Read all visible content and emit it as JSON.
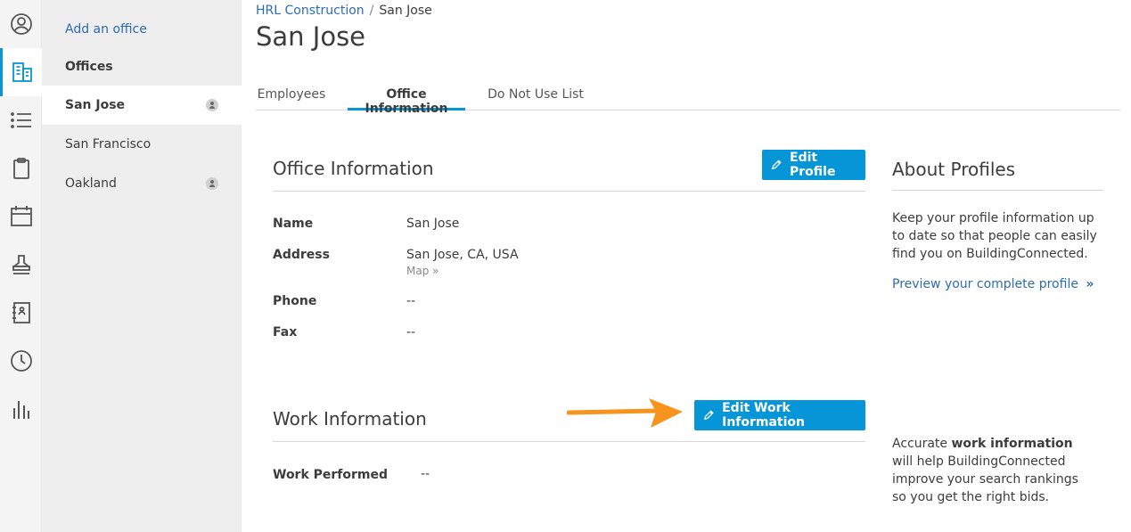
{
  "rail": {
    "items": [
      {
        "icon": "user-circle-icon"
      },
      {
        "icon": "building-icon",
        "active": true
      },
      {
        "icon": "list-icon"
      },
      {
        "icon": "clipboard-icon"
      },
      {
        "icon": "calendar-icon"
      },
      {
        "icon": "stamp-icon"
      },
      {
        "icon": "contacts-book-icon"
      },
      {
        "icon": "clock-icon"
      },
      {
        "icon": "bar-chart-icon"
      }
    ]
  },
  "offices_panel": {
    "add_office": "Add an office",
    "title": "Offices",
    "items": [
      {
        "label": "San Jose",
        "selected": true,
        "has_user": true
      },
      {
        "label": "San Francisco",
        "selected": false,
        "has_user": false
      },
      {
        "label": "Oakland",
        "selected": false,
        "has_user": true
      }
    ]
  },
  "breadcrumb": {
    "parent": "HRL Construction",
    "separator": "/",
    "current": "San Jose"
  },
  "page_title": "San Jose",
  "tabs": [
    {
      "label": "Employees",
      "active": false
    },
    {
      "label": "Office Information",
      "active": true
    },
    {
      "label": "Do Not Use List",
      "active": false
    }
  ],
  "office_info": {
    "title": "Office Information",
    "edit_button": "Edit Profile",
    "fields": {
      "name_label": "Name",
      "name_value": "San Jose",
      "address_label": "Address",
      "address_value": "San Jose, CA, USA",
      "map_link": "Map »",
      "phone_label": "Phone",
      "phone_value": "--",
      "fax_label": "Fax",
      "fax_value": "--"
    }
  },
  "work_info": {
    "title": "Work Information",
    "edit_button": "Edit Work Information",
    "work_performed_label": "Work Performed",
    "work_performed_value": "--"
  },
  "about": {
    "title": "About Profiles",
    "text": "Keep your profile information up to date so that people can easily find you on BuildingConnected.",
    "link": "Preview your complete profile",
    "work_note_prefix": "Accurate",
    "work_note_bold": "work information",
    "work_note_suffix": "will help BuildingConnected improve your search rankings so you get the right bids."
  },
  "colors": {
    "accent": "#0696d7",
    "link": "#2c6cb0",
    "annotation_arrow": "#f7941d"
  }
}
